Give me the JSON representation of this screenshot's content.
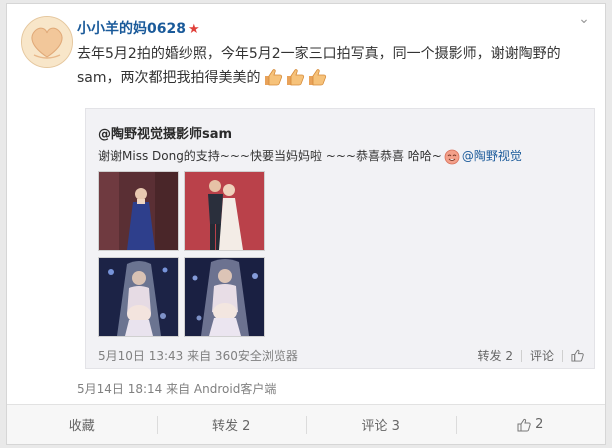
{
  "post": {
    "username": "小小羊的妈0628",
    "text_line1": "去年5月2拍的婚纱照，今年5月2一家三口拍写真，同一个摄影师，谢谢陶野的",
    "text_line2": "sam，两次都把我拍得美美的",
    "thumbs_icon": "thumbs-up-icon",
    "meta": "5月14日 18:14 来自 Android客户端"
  },
  "repost": {
    "author": "@陶野视觉摄影师sam",
    "text": "谢谢Miss Dong的支持~~~快要当妈妈啦 ~~~恭喜恭喜 哈哈~",
    "mention": "@陶野视觉",
    "meta": "5月10日 13:43 来自 360安全浏览器",
    "actions": {
      "repost_label": "转发 2",
      "comment_label": "评论"
    }
  },
  "actions": {
    "favorite": "收藏",
    "repost": "转发 2",
    "comment": "评论 3",
    "like": "2"
  },
  "colors": {
    "link": "#1a5a9a",
    "star": "#e0403a",
    "background": "#e9e9e9"
  }
}
